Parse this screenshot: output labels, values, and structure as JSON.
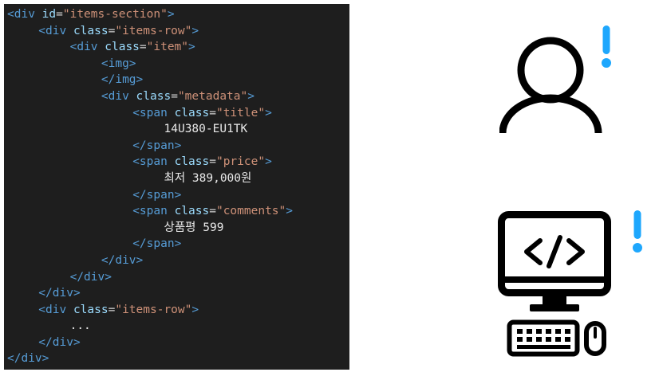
{
  "code": {
    "lines": [
      {
        "indent": 0,
        "tokens": [
          [
            "tag",
            "<div"
          ],
          [
            "pun",
            " "
          ],
          [
            "attr",
            "id"
          ],
          [
            "pun",
            "="
          ],
          [
            "str",
            "\"items-section\""
          ],
          [
            "tag",
            ">"
          ]
        ]
      },
      {
        "indent": 1,
        "tokens": [
          [
            "tag",
            "<div"
          ],
          [
            "pun",
            " "
          ],
          [
            "attr",
            "class"
          ],
          [
            "pun",
            "="
          ],
          [
            "str",
            "\"items-row\""
          ],
          [
            "tag",
            ">"
          ]
        ]
      },
      {
        "indent": 2,
        "tokens": [
          [
            "tag",
            "<div"
          ],
          [
            "pun",
            " "
          ],
          [
            "attr",
            "class"
          ],
          [
            "pun",
            "="
          ],
          [
            "str",
            "\"item\""
          ],
          [
            "tag",
            ">"
          ]
        ]
      },
      {
        "indent": 3,
        "tokens": [
          [
            "tag",
            "<img>"
          ]
        ]
      },
      {
        "indent": 3,
        "tokens": [
          [
            "tag",
            "</img>"
          ]
        ]
      },
      {
        "indent": 3,
        "tokens": [
          [
            "tag",
            "<div"
          ],
          [
            "pun",
            " "
          ],
          [
            "attr",
            "class"
          ],
          [
            "pun",
            "="
          ],
          [
            "str",
            "\"metadata\""
          ],
          [
            "tag",
            ">"
          ]
        ]
      },
      {
        "indent": 4,
        "tokens": [
          [
            "tag",
            "<span"
          ],
          [
            "pun",
            " "
          ],
          [
            "attr",
            "class"
          ],
          [
            "pun",
            "="
          ],
          [
            "str",
            "\"title\""
          ],
          [
            "tag",
            ">"
          ]
        ]
      },
      {
        "indent": 5,
        "tokens": [
          [
            "txt",
            "14U380-EU1TK"
          ]
        ]
      },
      {
        "indent": 4,
        "tokens": [
          [
            "tag",
            "</span>"
          ]
        ]
      },
      {
        "indent": 4,
        "tokens": [
          [
            "tag",
            "<span"
          ],
          [
            "pun",
            " "
          ],
          [
            "attr",
            "class"
          ],
          [
            "pun",
            "="
          ],
          [
            "str",
            "\"price\""
          ],
          [
            "tag",
            ">"
          ]
        ]
      },
      {
        "indent": 5,
        "tokens": [
          [
            "txt",
            "최저 389,000원"
          ]
        ]
      },
      {
        "indent": 4,
        "tokens": [
          [
            "tag",
            "</span>"
          ]
        ]
      },
      {
        "indent": 4,
        "tokens": [
          [
            "tag",
            "<span"
          ],
          [
            "pun",
            " "
          ],
          [
            "attr",
            "class"
          ],
          [
            "pun",
            "="
          ],
          [
            "str",
            "\"comments\""
          ],
          [
            "tag",
            ">"
          ]
        ]
      },
      {
        "indent": 5,
        "tokens": [
          [
            "txt",
            "상품평 599"
          ]
        ]
      },
      {
        "indent": 4,
        "tokens": [
          [
            "tag",
            "</span>"
          ]
        ]
      },
      {
        "indent": 3,
        "tokens": [
          [
            "tag",
            "</div>"
          ]
        ]
      },
      {
        "indent": 2,
        "tokens": [
          [
            "tag",
            "</div>"
          ]
        ]
      },
      {
        "indent": 1,
        "tokens": [
          [
            "tag",
            "</div>"
          ]
        ]
      },
      {
        "indent": 1,
        "tokens": [
          [
            "tag",
            "<div"
          ],
          [
            "pun",
            " "
          ],
          [
            "attr",
            "class"
          ],
          [
            "pun",
            "="
          ],
          [
            "str",
            "\"items-row\""
          ],
          [
            "tag",
            ">"
          ]
        ]
      },
      {
        "indent": 2,
        "tokens": [
          [
            "txt",
            "..."
          ]
        ]
      },
      {
        "indent": 1,
        "tokens": [
          [
            "tag",
            "</div>"
          ]
        ]
      },
      {
        "indent": 0,
        "tokens": [
          [
            "tag",
            "</div>"
          ]
        ]
      }
    ]
  },
  "icons": {
    "user": "user-icon",
    "computer": "computer-code-icon",
    "alert": "exclamation-icon"
  },
  "colors": {
    "code_background": "#1e1e1e",
    "tag": "#569cd6",
    "attribute": "#9cdcfe",
    "string": "#ce9178",
    "text": "#e8e8e8",
    "icon": "#000000",
    "alert": "#1ea7fd"
  }
}
